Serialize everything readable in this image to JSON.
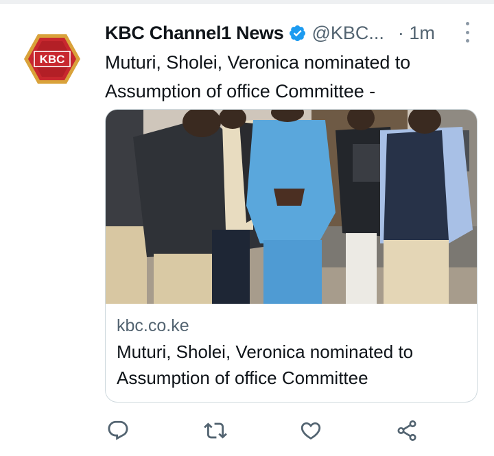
{
  "tweet": {
    "author_name": "KBC Channel1 News",
    "handle": "@KBC...",
    "separator_time": "· 1m",
    "text": "Muturi, Sholei, Veronica nominated to Assumption of office Committee -",
    "avatar_logo_text": "KBC",
    "verified_icon": "verified-badge-icon"
  },
  "link_card": {
    "domain": "kbc.co.ke",
    "title": "Muturi, Sholei, Veronica nominated to Assumption of office Committee"
  },
  "actions": {
    "icons": [
      "reply-icon",
      "retweet-icon",
      "like-icon",
      "share-icon"
    ]
  },
  "colors": {
    "verified": "#1d9bf0",
    "secondary_text": "#536471",
    "border": "#cfd9de",
    "action_icon": "#536471",
    "logo_red": "#c8272e",
    "logo_gold": "#d9a23a"
  }
}
